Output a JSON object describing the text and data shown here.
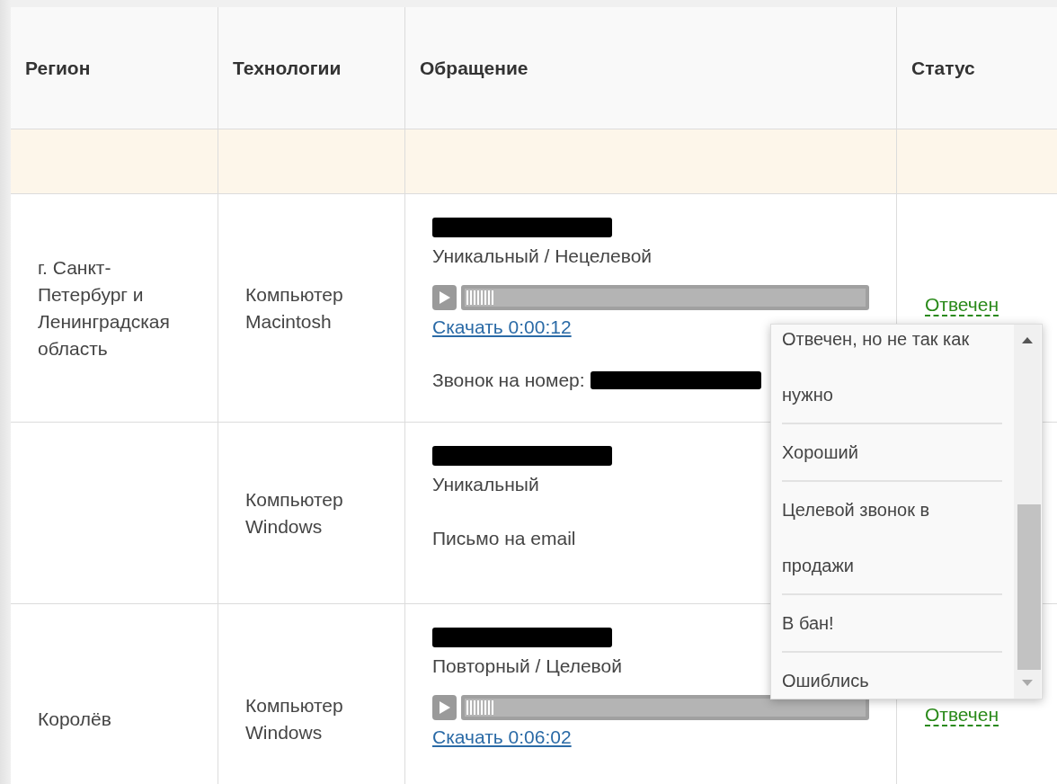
{
  "table": {
    "columns": [
      "Регион",
      "Технологии",
      "Обращение",
      "Статус"
    ],
    "rows": [
      {
        "region": "г. Санкт-Петербург и Ленинградская область",
        "technology": "Компьютер Macintosh",
        "call": [
          {
            "kind": "redacted"
          },
          {
            "kind": "type",
            "text": "Уникальный / Нецелевой"
          },
          {
            "kind": "player",
            "level": 0.07
          },
          {
            "kind": "link",
            "text": "Скачать 0:00:12"
          },
          {
            "kind": "phone",
            "text": "Звонок на номер:"
          }
        ],
        "status": "Отвечен"
      },
      {
        "technology": "Компьютер Windows",
        "call": [
          {
            "kind": "redacted"
          },
          {
            "kind": "type",
            "text": "Уникальный"
          },
          {
            "kind": "note",
            "text": "Письмо на email"
          }
        ]
      },
      {
        "region": "Королёв",
        "technology": "Компьютер Windows",
        "call": [
          {
            "kind": "redacted"
          },
          {
            "kind": "type",
            "text": "Повторный / Целевой"
          },
          {
            "kind": "player",
            "level": 0.07
          },
          {
            "kind": "link",
            "text": "Скачать 0:06:02"
          }
        ],
        "status": "Отвечен"
      }
    ]
  },
  "status_menu": {
    "options": [
      "Отвечен, но не так как нужно",
      "Хороший",
      "Целевой звонок в продажи",
      "В бан!",
      "Ошиблись"
    ]
  }
}
